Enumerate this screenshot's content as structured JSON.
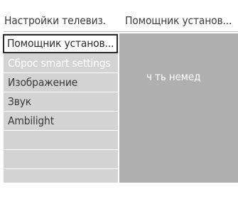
{
  "header": {
    "left_title": "Настройки телевиз.",
    "right_title": "Помощник установ..."
  },
  "menu": {
    "items": [
      {
        "label": "Помощник установ...",
        "state": "selected"
      },
      {
        "label": "Сброс smart settings",
        "state": "dim"
      },
      {
        "label": "Изображение",
        "state": "normal"
      },
      {
        "label": "Звук",
        "state": "normal"
      },
      {
        "label": "Ambilight",
        "state": "normal"
      }
    ]
  },
  "detail": {
    "text": "ч  ть немед"
  },
  "colors": {
    "list_bg": "#d3d3d3",
    "detail_bg": "#afafaf",
    "highlight_border": "#2b2b2b"
  }
}
